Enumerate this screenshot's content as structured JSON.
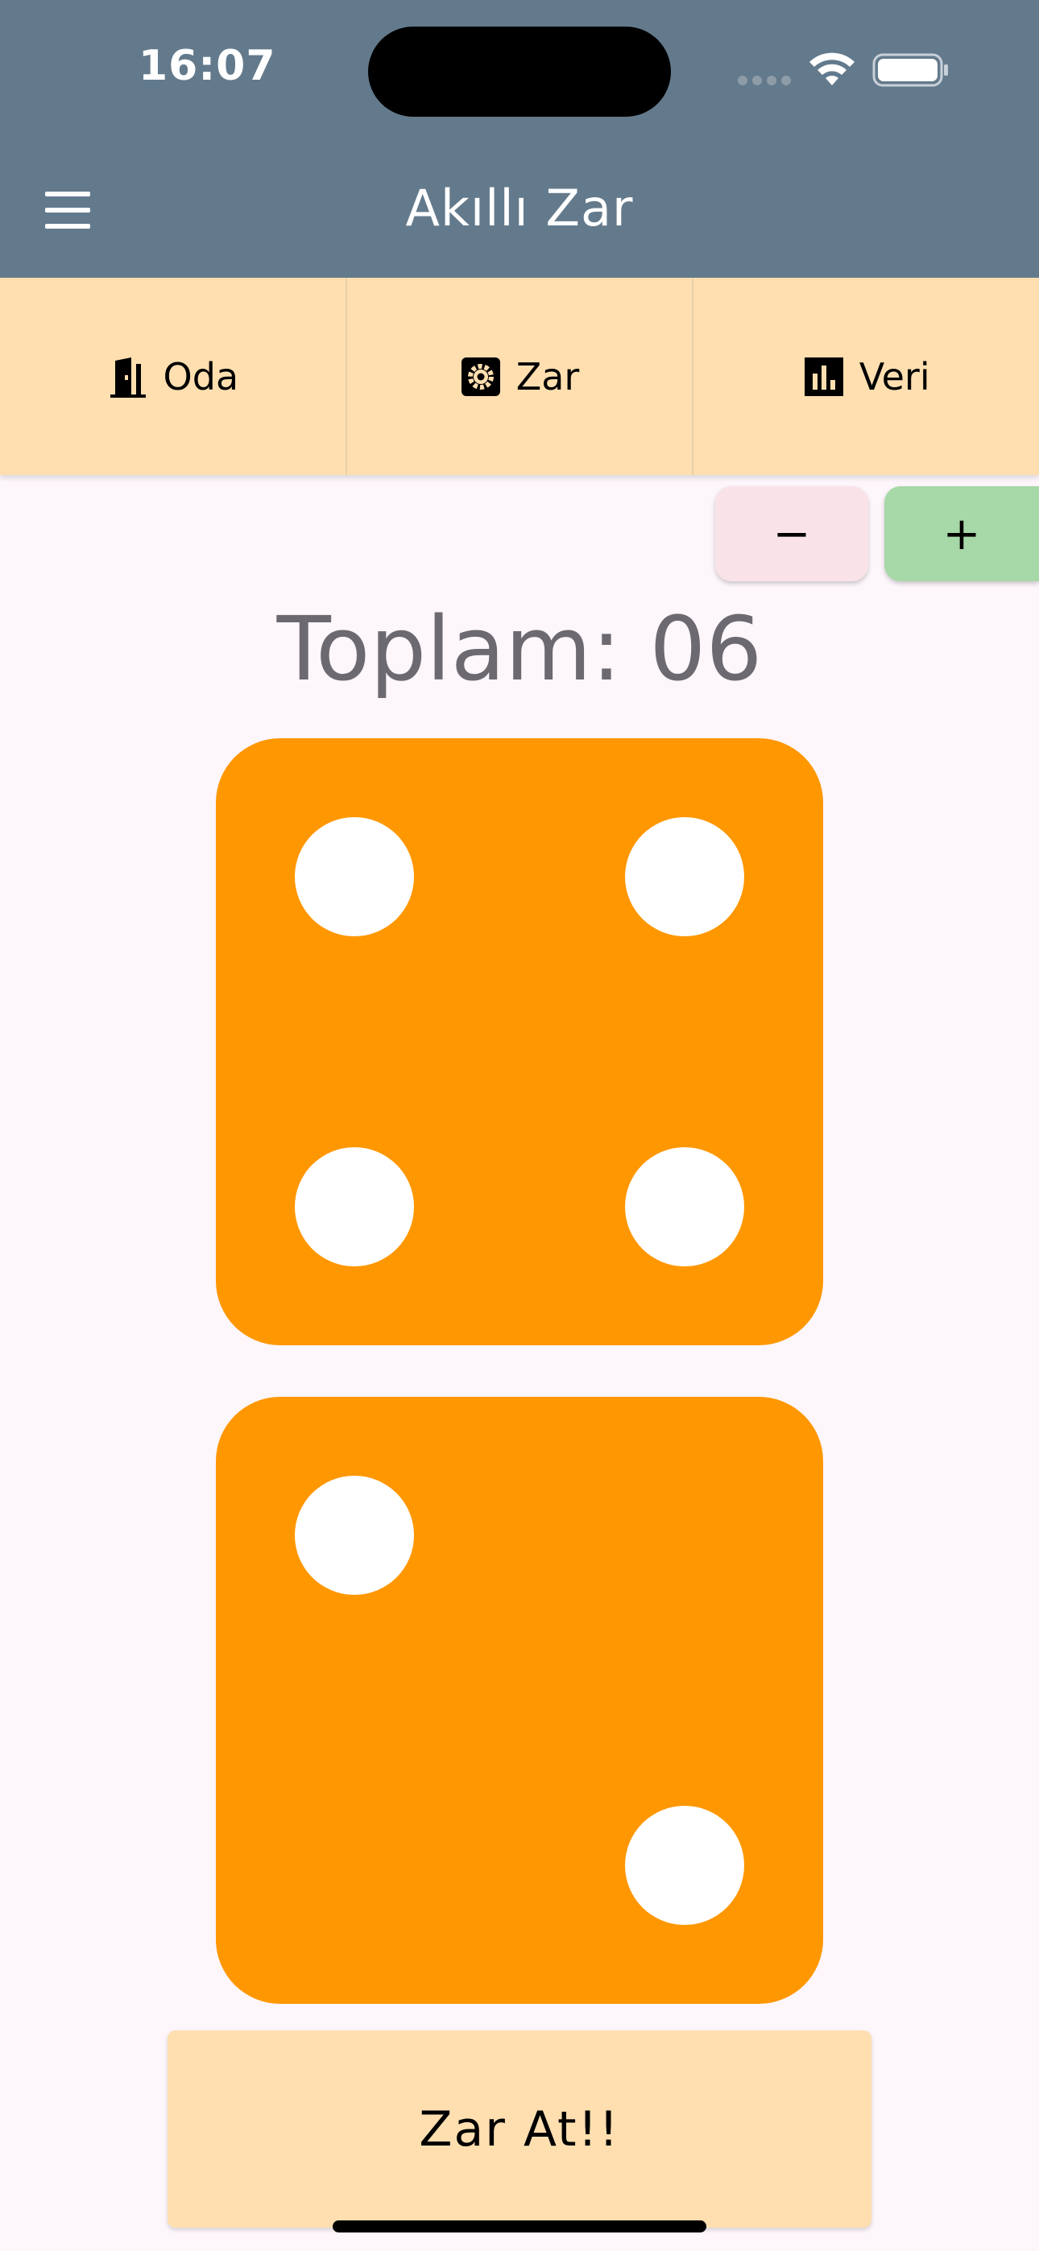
{
  "status_bar": {
    "time": "16:07"
  },
  "app_bar": {
    "title": "Akıllı Zar",
    "menu_icon": "hamburger-menu-icon",
    "background": "#637a8c"
  },
  "tabs": [
    {
      "label": "Oda",
      "icon": "door-icon"
    },
    {
      "label": "Zar",
      "icon": "gear-icon"
    },
    {
      "label": "Veri",
      "icon": "bar-chart-icon"
    }
  ],
  "counter_buttons": {
    "minus_label": "−",
    "plus_label": "+",
    "minus_color": "#f9e3e9",
    "plus_color": "#a7d8a7"
  },
  "total": {
    "text": "Toplam: 06"
  },
  "dice": [
    {
      "value": 4,
      "color": "#ff9700"
    },
    {
      "value": 2,
      "color": "#ff9700"
    }
  ],
  "roll_button": {
    "label": "Zar At!!",
    "color": "#ffdfb0"
  }
}
